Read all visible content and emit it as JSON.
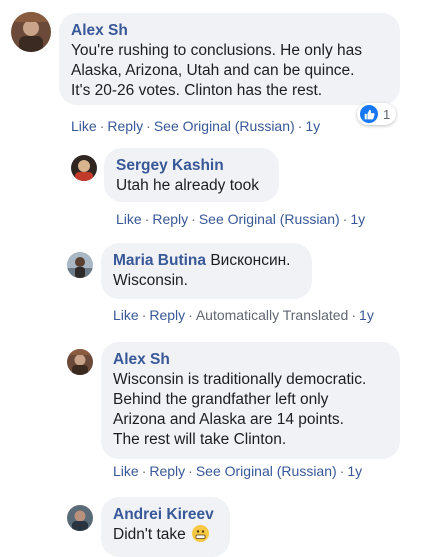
{
  "comments": [
    {
      "author": "Alex Sh",
      "text_lines": [
        "You're rushing to conclusions. He only has",
        "Alaska, Arizona, Utah and can be quince.",
        "It's 20-26 votes. Clinton has the rest."
      ],
      "actions": {
        "like": "Like",
        "reply": "Reply",
        "translation": "See Original (Russian)",
        "time": "1y"
      },
      "reaction": {
        "icon": "thumbs-up-icon",
        "count": "1"
      }
    },
    {
      "author": "Sergey Kashin",
      "text_lines": [
        "Utah he already took"
      ],
      "actions": {
        "like": "Like",
        "reply": "Reply",
        "translation": "See Original (Russian)",
        "time": "1y"
      }
    },
    {
      "author": "Maria Butina",
      "original_text": "Висконсин.",
      "text_lines": [
        "Wisconsin."
      ],
      "actions": {
        "like": "Like",
        "reply": "Reply",
        "translation": "Automatically Translated",
        "time": "1y"
      }
    },
    {
      "author": "Alex Sh",
      "text_lines": [
        "Wisconsin is traditionally democratic.",
        "Behind the grandfather left only",
        "Arizona and Alaska are 14 points.",
        "The rest will take Clinton."
      ],
      "actions": {
        "like": "Like",
        "reply": "Reply",
        "translation": "See Original (Russian)",
        "time": "1y"
      }
    },
    {
      "author": "Andrei Kireev",
      "text_lines": [
        "Didn't take"
      ],
      "emoji": "grimacing-face-icon"
    }
  ],
  "separators": {
    "dot": "·"
  },
  "colors": {
    "link": "#385898",
    "bubble": "#f0f2f5",
    "meta": "#606770",
    "like_badge": "#1877f2"
  }
}
